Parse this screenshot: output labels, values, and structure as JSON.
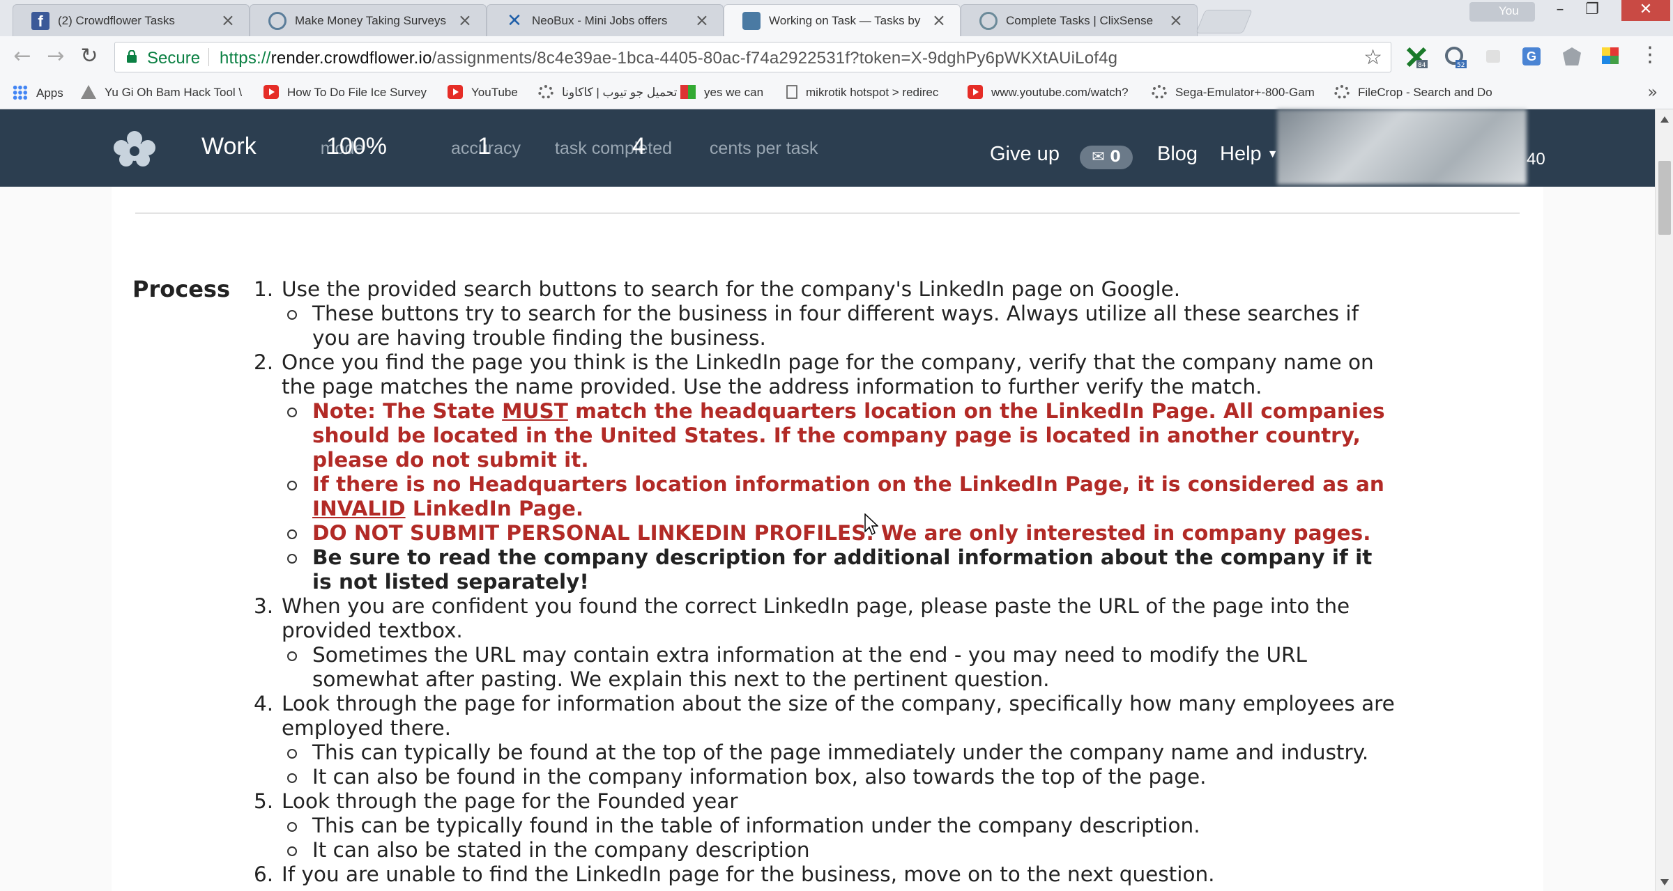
{
  "browser": {
    "tabs": [
      {
        "title": "(2) Crowdflower Tasks",
        "icon": "facebook-icon"
      },
      {
        "title": "Make Money Taking Surveys",
        "icon": "crowd-icon"
      },
      {
        "title": "NeoBux - Mini Jobs offers",
        "icon": "neobux-icon"
      },
      {
        "title": "Working on Task — Tasks by",
        "icon": "crowdflower-icon"
      },
      {
        "title": "Complete Tasks | ClixSense",
        "icon": "clixsense-icon"
      }
    ],
    "active_tab": 3,
    "profile_label": "You",
    "secure_label": "Secure",
    "url_proto": "https://",
    "url_host": "render.crowdflower.io",
    "url_path": "/assignments/8c4e39ae-1bca-4405-80ac-f74a2922531f?token=X-9dghPy6pWKXtAUiLof4g",
    "extension_badges": {
      "ext1": "84",
      "ext2": "52"
    },
    "bookmarks": [
      {
        "label": "Apps",
        "icon": "apps-icon"
      },
      {
        "label": "Yu Gi Oh Bam Hack Tool \\",
        "icon": "bookmark-icon"
      },
      {
        "label": "How To Do File Ice Survey",
        "icon": "youtube-icon"
      },
      {
        "label": "YouTube",
        "icon": "youtube-icon"
      },
      {
        "label": "تحميل جو تيوب | كاكاونا",
        "icon": "bookmark-icon"
      },
      {
        "label": "yes we can",
        "icon": "bookmark-icon"
      },
      {
        "label": "mikrotik hotspot > redirec",
        "icon": "page-icon"
      },
      {
        "label": "www.youtube.com/watch?",
        "icon": "youtube-icon"
      },
      {
        "label": "Sega-Emulator+-800-Gam",
        "icon": "gear-icon"
      },
      {
        "label": "FileCrop - Search and Do",
        "icon": "gear-icon"
      }
    ],
    "more_bookmarks": "»"
  },
  "app": {
    "mode_value": "Work",
    "mode_label": "mode",
    "accuracy_value": "100%",
    "accuracy_label": "accuracy",
    "tasks_value": "1",
    "tasks_label": "task completed",
    "cents_value": "4",
    "cents_label": "cents per task",
    "give_up": "Give up",
    "mail_count": "0",
    "blog": "Blog",
    "help": "Help",
    "user_count": "40"
  },
  "instructions": {
    "label": "Process",
    "s1": "Use the provided search buttons to search for the company's LinkedIn page on Google.",
    "s1a": "These buttons try to search for the business in four different ways. Always utilize all these searches if you are having trouble finding the business.",
    "s2": "Once you find the page you think is the LinkedIn page for the company, verify that the company name on the page matches the name provided. Use the address information to further verify the match.",
    "s2a_pre": "Note: The State ",
    "s2a_u": "MUST",
    "s2a_post": " match the headquarters location on the LinkedIn Page. All companies should be located in the United States. If the company page is located in another country, please do not submit it.",
    "s2b_pre": "If there is no Headquarters location information on the LinkedIn Page, it is considered as an ",
    "s2b_u": "INVALID",
    "s2b_post": " LinkedIn Page.",
    "s2c": "DO NOT SUBMIT PERSONAL LINKEDIN PROFILES. We are only interested in company pages.",
    "s2d": "Be sure to read the company description for additional information about the company if it is not listed separately!",
    "s3": "When you are confident you found the correct LinkedIn page, please paste the URL of the page into the provided textbox.",
    "s3a": "Sometimes the URL may contain extra information at the end - you may need to modify the URL somewhat after pasting. We explain this next to the pertinent question.",
    "s4": "Look through the page for information about the size of the company, specifically how many employees are employed there.",
    "s4a": "This can typically be found at the top of the page immediately under the company name and industry.",
    "s4b": "It can also be found in the company information box, also towards the top of the page.",
    "s5": "Look through the page for the Founded year",
    "s5a": "This can be typically found in the table of information under the company description.",
    "s5b": "It can also be stated in the company description",
    "s6": "If you are unable to find the LinkedIn page for the business, move on to the next question."
  },
  "colors": {
    "nav_bg": "#2c3e50",
    "warning_red": "#b22a26"
  }
}
